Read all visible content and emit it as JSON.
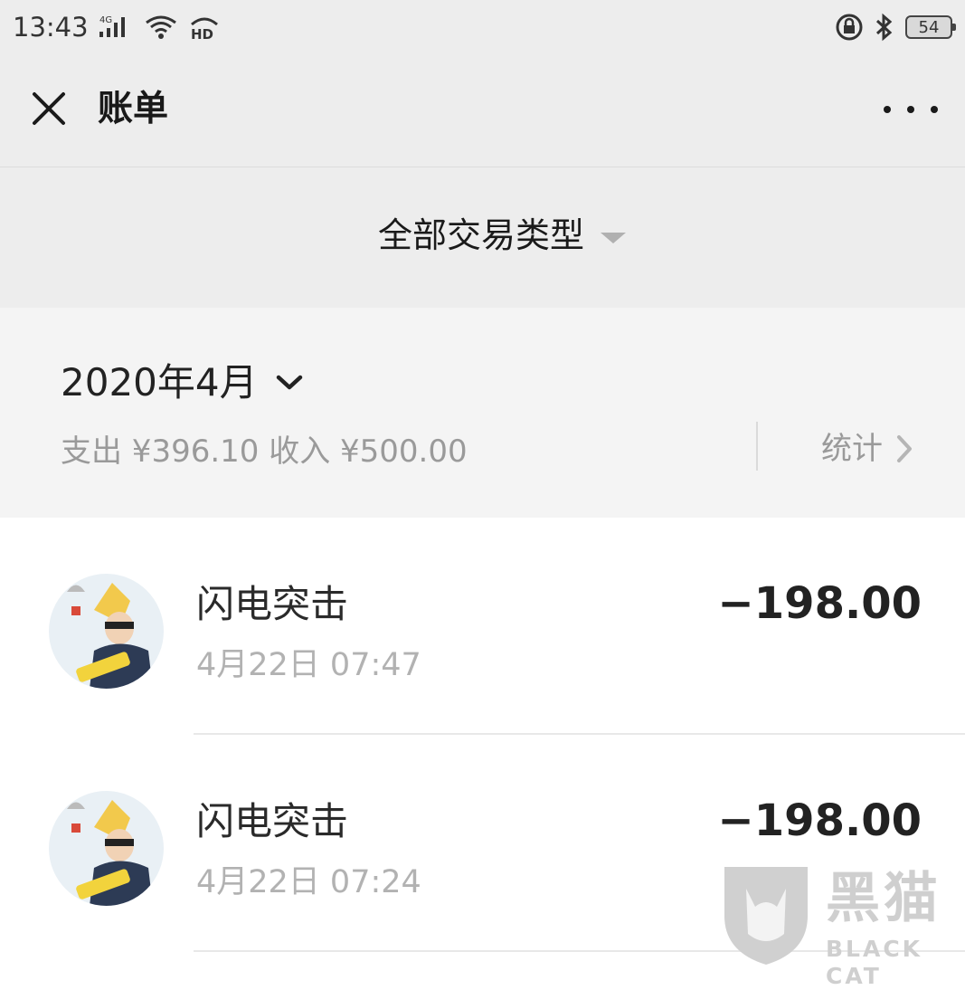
{
  "status_bar": {
    "time": "13:43",
    "network_label": "4G",
    "hd_label": "HD",
    "battery": "54"
  },
  "nav": {
    "title": "账单",
    "close_icon": "close-icon",
    "more_icon": "more-dots-icon"
  },
  "filter": {
    "label": "全部交易类型"
  },
  "month": {
    "label": "2020年4月",
    "summary": "支出 ¥396.10 收入 ¥500.00",
    "stats_label": "统计"
  },
  "transactions": [
    {
      "name": "闪电突击",
      "time": "4月22日 07:47",
      "amount": "−198.00"
    },
    {
      "name": "闪电突击",
      "time": "4月22日 07:24",
      "amount": "−198.00"
    }
  ],
  "watermark": {
    "text": "黑猫",
    "subtext": "BLACK CAT"
  },
  "colors": {
    "header_bg": "#ededed",
    "section_bg": "#f4f4f4",
    "muted_text": "#9a9a9a"
  }
}
